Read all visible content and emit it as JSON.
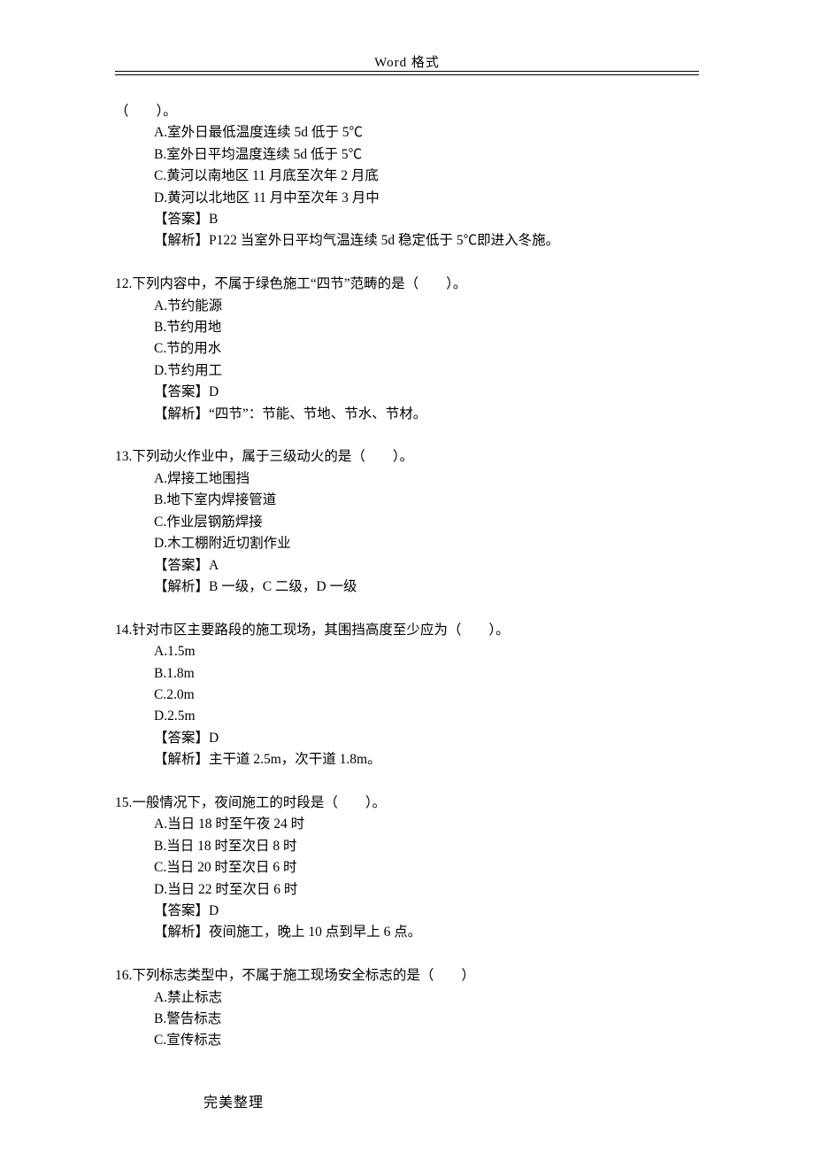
{
  "header": {
    "title": "Word 格式"
  },
  "q11": {
    "cont_stem": "（　　）。",
    "A": "A.室外日最低温度连续 5d 低于 5℃",
    "B": "B.室外日平均温度连续 5d 低于 5℃",
    "C": "C.黄河以南地区 11 月底至次年 2 月底",
    "D": "D.黄河以北地区 11 月中至次年 3 月中",
    "answer": "【答案】B",
    "analysis": "【解析】P122 当室外日平均气温连续 5d 稳定低于 5℃即进入冬施。"
  },
  "q12": {
    "stem": "12.下列内容中，不属于绿色施工“四节”范畴的是（　　）。",
    "A": "A.节约能源",
    "B": "B.节约用地",
    "C": "C.节的用水",
    "D": "D.节约用工",
    "answer": "【答案】D",
    "analysis": "【解析】“四节”：节能、节地、节水、节材。"
  },
  "q13": {
    "stem": "13.下列动火作业中，属于三级动火的是（　　）。",
    "A": "A.焊接工地围挡",
    "B": "B.地下室内焊接管道",
    "C": "C.作业层钢筋焊接",
    "D": "D.木工棚附近切割作业",
    "answer": "【答案】A",
    "analysis": "【解析】B 一级，C 二级，D 一级"
  },
  "q14": {
    "stem": "14.针对市区主要路段的施工现场，其围挡高度至少应为（　　）。",
    "A": "A.1.5m",
    "B": "B.1.8m",
    "C": "C.2.0m",
    "D": "D.2.5m",
    "answer": "【答案】D",
    "analysis": "【解析】主干道 2.5m，次干道 1.8m。"
  },
  "q15": {
    "stem": "15.一般情况下，夜间施工的时段是（　　）。",
    "A": "A.当日 18 时至午夜 24 时",
    "B": "B.当日 18 时至次日 8 时",
    "C": "C.当日 20 时至次日 6 时",
    "D": "D.当日 22 时至次日 6 时",
    "answer": "【答案】D",
    "analysis": "【解析】夜间施工，晚上 10 点到早上 6 点。"
  },
  "q16": {
    "stem": "16.下列标志类型中，不属于施工现场安全标志的是（　　）",
    "A": "A.禁止标志",
    "B": "B.警告标志",
    "C": "C.宣传标志"
  },
  "footer": {
    "text": "完美整理"
  }
}
